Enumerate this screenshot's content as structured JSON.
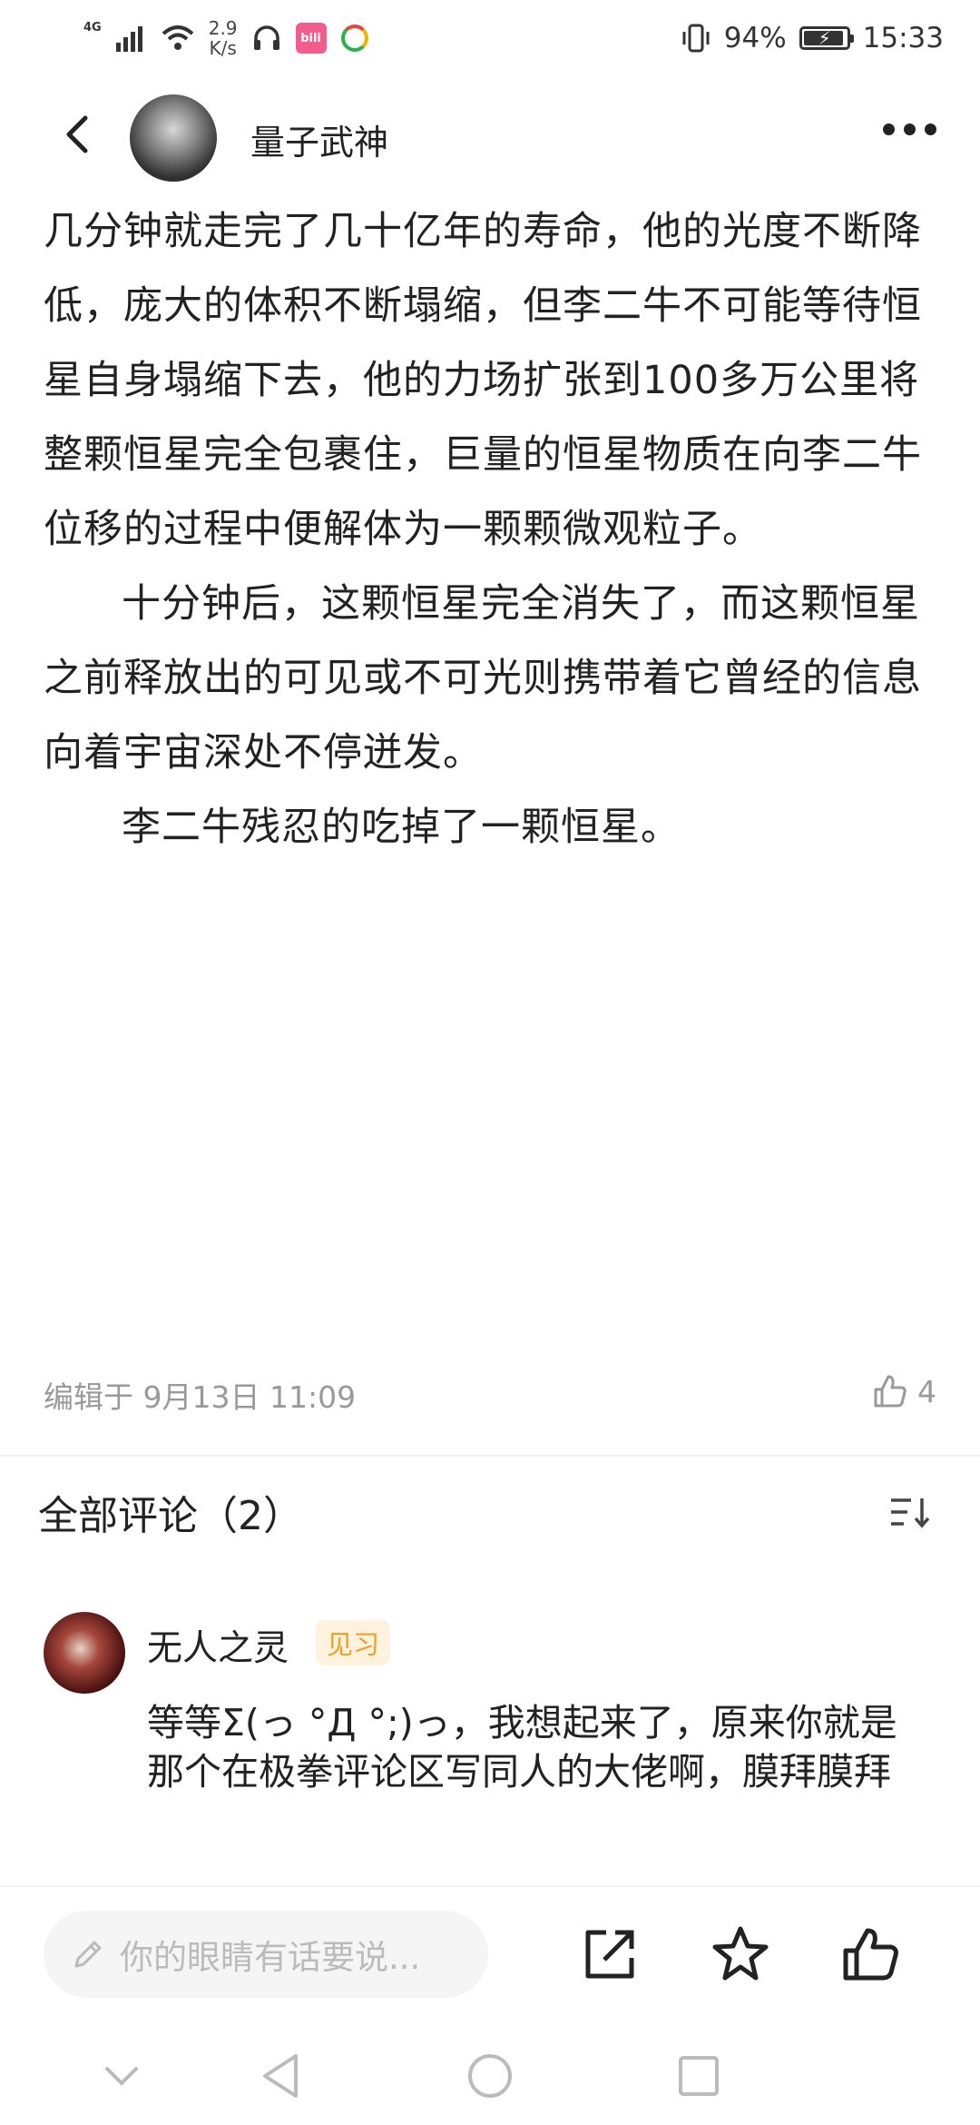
{
  "status_bar": {
    "network": "4G",
    "speed_value": "2.9",
    "speed_unit": "K/s",
    "battery_level": 0.94,
    "battery_text": "94%",
    "time": "15:33"
  },
  "header": {
    "author": "量子武神"
  },
  "article": {
    "paragraphs": [
      "几分钟就走完了几十亿年的寿命，他的光度不断降低，庞大的体积不断塌缩，但李二牛不可能等待恒星自身塌缩下去，他的力场扩张到100多万公里将整颗恒星完全包裹住，巨量的恒星物质在向李二牛位移的过程中便解体为一颗颗微观粒子。",
      "十分钟后，这颗恒星完全消失了，而这颗恒星之前释放出的可见或不可光则携带着它曾经的信息向着宇宙深处不停迸发。",
      "李二牛残忍的吃掉了一颗恒星。"
    ]
  },
  "meta": {
    "edited": "编辑于 9月13日 11:09",
    "like_count": "4"
  },
  "comments": {
    "heading": "全部评论（2）",
    "items": [
      {
        "user": "无人之灵",
        "badge": "见习",
        "text": "等等Σ(っ °Д °;)っ，我想起来了，原来你就是那个在极拳评论区写同人的大佬啊，膜拜膜拜"
      }
    ]
  },
  "bottom_bar": {
    "placeholder": "你的眼睛有话要说..."
  },
  "colors": {
    "badge_text": "#f0a020",
    "badge_bg": "#fff3e0",
    "muted": "#999999"
  }
}
